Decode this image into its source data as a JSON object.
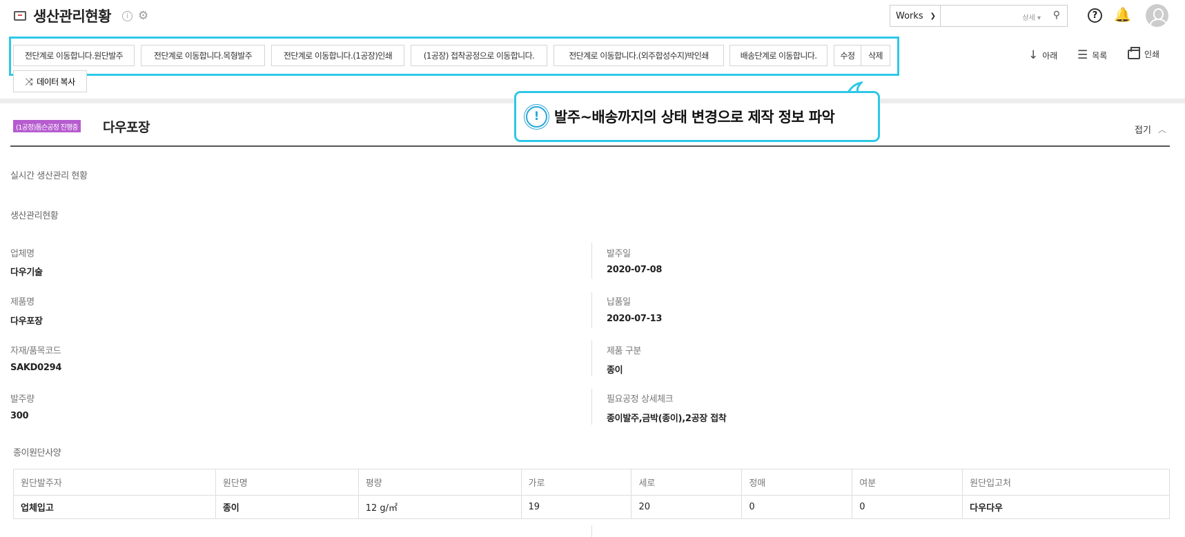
{
  "header": {
    "title": "생산관리현황",
    "info_icon": "i",
    "search_scope": "Works",
    "search_placeholder": "",
    "search_detail": "상세 ▾",
    "help_icon": "?"
  },
  "toolbar": {
    "buttons": [
      "전단계로 이동합니다.원단발주",
      "전단계로 이동합니다.목형발주",
      "전단계로 이동합니다.(1공장)인쇄",
      "(1공장) 접착공정으로 이동합니다.",
      "전단계로 이동합니다.(외주합성수지)박인쇄",
      "배송단계로 이동합니다.",
      "수정",
      "삭제"
    ],
    "copy_label": "데이터 복사",
    "actions": {
      "down": "아래",
      "list": "목록",
      "print": "인쇄"
    },
    "highlight_color": "#2dc8e6"
  },
  "callout": {
    "text": "발주~배송까지의 상태 변경으로 제작 정보 파악",
    "icon": "!"
  },
  "section": {
    "badge": "(1공정)톰슨공정 진행중",
    "badge_color": "#b65ccf",
    "title": "다우포장",
    "collapse_label": "접기"
  },
  "body": {
    "realtime_label": "실시간 생산관리 현황",
    "status_label": "생산관리현황",
    "left_fields": [
      {
        "label": "업체명",
        "value": "다우기술"
      },
      {
        "label": "제품명",
        "value": "다우포장"
      },
      {
        "label": "자재/품목코드",
        "value": "SAKD0294"
      },
      {
        "label": "발주량",
        "value": "300"
      }
    ],
    "right_fields": [
      {
        "label": "발주일",
        "value": "2020-07-08"
      },
      {
        "label": "납품일",
        "value": "2020-07-13"
      },
      {
        "label": "제품 구분",
        "value": "종이"
      },
      {
        "label": "필요공정 상세체크",
        "value": "종이발주,금박(종이),2공장 접착"
      }
    ],
    "paper_spec_label": "종이원단사양"
  },
  "paper_table": {
    "headers": [
      "원단발주자",
      "원단명",
      "평량",
      "가로",
      "세로",
      "정매",
      "여분",
      "원단입고처"
    ],
    "row": [
      "업체입고",
      "종이",
      "12 g/㎡",
      "19",
      "20",
      "0",
      "0",
      "다우다우"
    ]
  }
}
